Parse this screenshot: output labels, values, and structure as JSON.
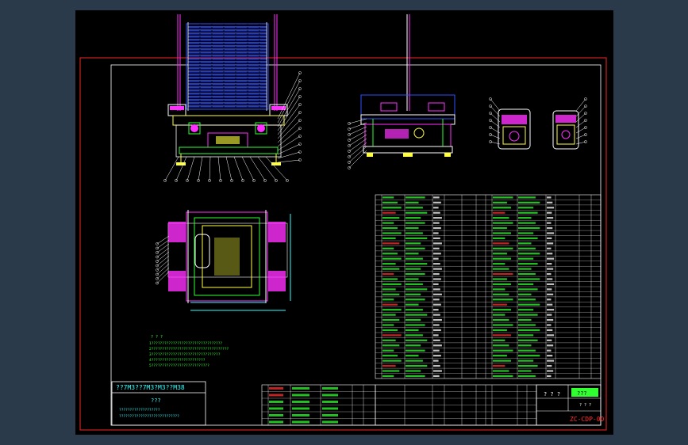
{
  "colors": {
    "workspace": "#2b3a4a",
    "canvas": "#000000",
    "frame_outer": "#cc2020",
    "frame_inner": "#ffffff",
    "blue": "#3050ff",
    "magenta": "#ff30ff",
    "yellow": "#ffff40",
    "green": "#30ff30",
    "cyan": "#30ffff",
    "red": "#ff3030",
    "white": "#ffffff"
  },
  "notes": {
    "title": "? ? ?",
    "lines": [
      "1?????????????????????????????????",
      "2????????????????????????????????????",
      "3????????????????????????????????",
      "4?????????????????????????",
      "5???????????????????????????"
    ]
  },
  "info_box": {
    "header": "??7M3??7M3?M3??M38",
    "title": "???",
    "lines": [
      "???????????????????",
      "????????????????????????????"
    ]
  },
  "title_block": {
    "title": "? ? ?",
    "logo_text": "???",
    "subtitle": "? ? ?",
    "drawing_number": "ZC-CDP-00"
  }
}
